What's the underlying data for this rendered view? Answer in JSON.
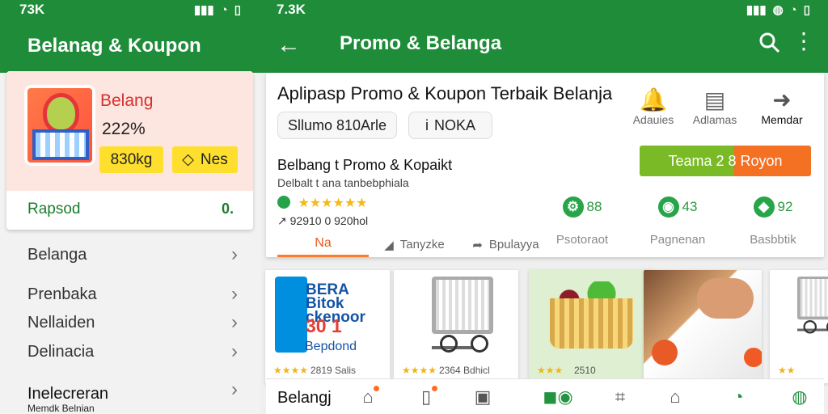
{
  "left": {
    "status_time": "73K",
    "status_icon": "location-icon",
    "title": "Belanag & Koupon",
    "card": {
      "title": "Belang",
      "percent": "222%",
      "pill_a": "830kg",
      "pill_b": "Nes",
      "footer_left": "Rapsod",
      "footer_right": "0."
    },
    "menu": [
      {
        "label": "Belanga"
      },
      {
        "label": "Prenbaka"
      },
      {
        "label": "Nellaiden"
      },
      {
        "label": "Delinacia"
      },
      {
        "label": "Inelecreran"
      }
    ],
    "footer": {
      "title": "Inelecreran",
      "subtitle": "Memdk Belnian"
    }
  },
  "right": {
    "status_time": "7.3K",
    "title": "Promo &  Belanga",
    "headline": "Aplipasp Promo & Koupon Terbaik Belanja",
    "chips": [
      "Sllumo 810Arle",
      "NOKA"
    ],
    "actions": [
      "Adauies",
      "Adlamas",
      "Memdar"
    ],
    "subhead": "Belbang t Promo & Kopaikt",
    "subline": "Delbalt t ana tanbebphiala",
    "rating_text": "★★★★★★",
    "rank_text": "↗ 92910 0 920hol",
    "cta": "Teama 2 8 Royon",
    "tabs": [
      "Na",
      "Tanyzke",
      "Bpulayya",
      "Psotoraot",
      "Pagnenan",
      "Basbbtik"
    ],
    "metrics": [
      {
        "value": "88"
      },
      {
        "value": "43"
      },
      {
        "value": "92"
      }
    ],
    "products": [
      {
        "title": "BERA Bitok ckenoor",
        "deal": "30 1",
        "label": "Bepdond",
        "rating": "★★★★",
        "meta": "2819   Salis"
      },
      {
        "rating": "★★★★",
        "meta": "2364   Bdhicl"
      },
      {
        "rating": "★★★",
        "meta": "2510"
      },
      {
        "rating": "",
        "meta": ""
      },
      {
        "rating": "★★",
        "meta": ""
      }
    ],
    "bottom_nav": {
      "label": "Belangj",
      "icons": [
        "store-icon",
        "phone-icon",
        "chart-icon",
        "shop-toggle-icon",
        "scan-icon",
        "home-icon",
        "cart-icon",
        "profile-icon"
      ]
    }
  },
  "colors": {
    "primary": "#1e8c39",
    "accent_orange": "#f47023",
    "accent_green": "#7aba27",
    "rating_gold": "#f2b91b"
  }
}
